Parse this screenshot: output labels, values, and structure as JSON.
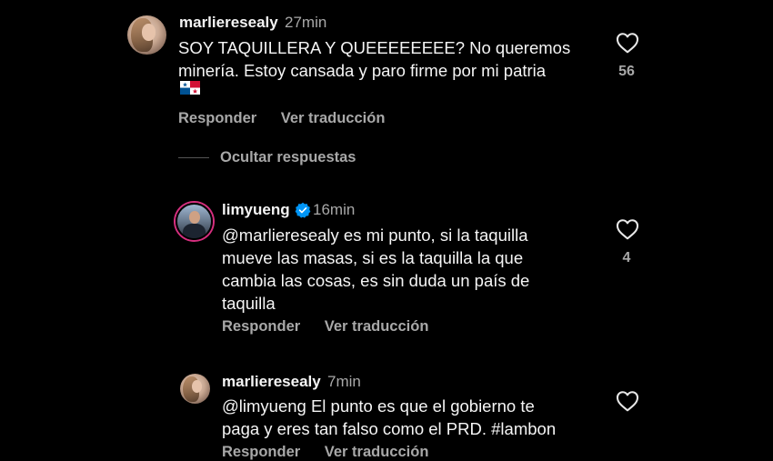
{
  "comments": [
    {
      "username": "marlieresealy",
      "time": "27min",
      "lines": [
        "SOY TAQUILLERA Y QUEEEEEEEE? No queremos",
        "minería. Estoy cansada y paro firme por mi patria"
      ],
      "flag": "panama-flag-emoji",
      "likes": "56",
      "reply_label": "Responder",
      "translate_label": "Ver traducción"
    },
    {
      "username": "limyueng",
      "verified": true,
      "time": "16min",
      "lines": [
        "@marlieresealy es mi punto, si la taquilla",
        "mueve las masas, si es la taquilla la que",
        "cambia las cosas, es sin duda un país de",
        "taquilla"
      ],
      "likes": "4",
      "reply_label": "Responder",
      "translate_label": "Ver traducción"
    },
    {
      "username": "marlieresealy",
      "time": "7min",
      "lines": [
        "@limyueng El punto es que el gobierno te",
        "paga y eres tan falso como el PRD. #lambon"
      ],
      "reply_label": "Responder",
      "translate_label": "Ver traducción"
    }
  ],
  "hide_replies_label": "Ocultar respuestas",
  "colors": {
    "background": "#000000",
    "primary_text": "#f5f5f5",
    "secondary_text": "#a8a8a8",
    "verified_blue": "#0095f6"
  },
  "icons": {
    "like": "heart-outline-icon",
    "verified": "verified-badge-icon"
  }
}
